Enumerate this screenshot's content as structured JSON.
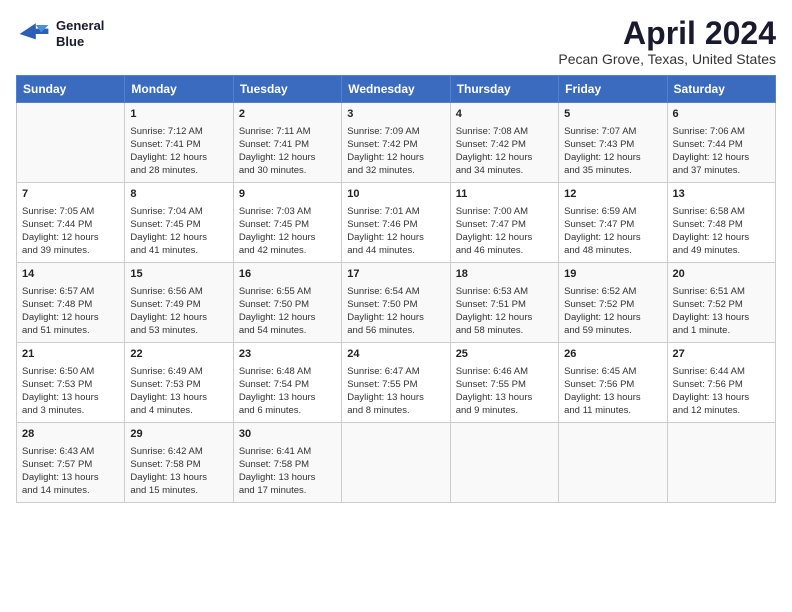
{
  "logo": {
    "line1": "General",
    "line2": "Blue"
  },
  "title": "April 2024",
  "subtitle": "Pecan Grove, Texas, United States",
  "days_header": [
    "Sunday",
    "Monday",
    "Tuesday",
    "Wednesday",
    "Thursday",
    "Friday",
    "Saturday"
  ],
  "weeks": [
    [
      {
        "day": "",
        "info": ""
      },
      {
        "day": "1",
        "info": "Sunrise: 7:12 AM\nSunset: 7:41 PM\nDaylight: 12 hours\nand 28 minutes."
      },
      {
        "day": "2",
        "info": "Sunrise: 7:11 AM\nSunset: 7:41 PM\nDaylight: 12 hours\nand 30 minutes."
      },
      {
        "day": "3",
        "info": "Sunrise: 7:09 AM\nSunset: 7:42 PM\nDaylight: 12 hours\nand 32 minutes."
      },
      {
        "day": "4",
        "info": "Sunrise: 7:08 AM\nSunset: 7:42 PM\nDaylight: 12 hours\nand 34 minutes."
      },
      {
        "day": "5",
        "info": "Sunrise: 7:07 AM\nSunset: 7:43 PM\nDaylight: 12 hours\nand 35 minutes."
      },
      {
        "day": "6",
        "info": "Sunrise: 7:06 AM\nSunset: 7:44 PM\nDaylight: 12 hours\nand 37 minutes."
      }
    ],
    [
      {
        "day": "7",
        "info": "Sunrise: 7:05 AM\nSunset: 7:44 PM\nDaylight: 12 hours\nand 39 minutes."
      },
      {
        "day": "8",
        "info": "Sunrise: 7:04 AM\nSunset: 7:45 PM\nDaylight: 12 hours\nand 41 minutes."
      },
      {
        "day": "9",
        "info": "Sunrise: 7:03 AM\nSunset: 7:45 PM\nDaylight: 12 hours\nand 42 minutes."
      },
      {
        "day": "10",
        "info": "Sunrise: 7:01 AM\nSunset: 7:46 PM\nDaylight: 12 hours\nand 44 minutes."
      },
      {
        "day": "11",
        "info": "Sunrise: 7:00 AM\nSunset: 7:47 PM\nDaylight: 12 hours\nand 46 minutes."
      },
      {
        "day": "12",
        "info": "Sunrise: 6:59 AM\nSunset: 7:47 PM\nDaylight: 12 hours\nand 48 minutes."
      },
      {
        "day": "13",
        "info": "Sunrise: 6:58 AM\nSunset: 7:48 PM\nDaylight: 12 hours\nand 49 minutes."
      }
    ],
    [
      {
        "day": "14",
        "info": "Sunrise: 6:57 AM\nSunset: 7:48 PM\nDaylight: 12 hours\nand 51 minutes."
      },
      {
        "day": "15",
        "info": "Sunrise: 6:56 AM\nSunset: 7:49 PM\nDaylight: 12 hours\nand 53 minutes."
      },
      {
        "day": "16",
        "info": "Sunrise: 6:55 AM\nSunset: 7:50 PM\nDaylight: 12 hours\nand 54 minutes."
      },
      {
        "day": "17",
        "info": "Sunrise: 6:54 AM\nSunset: 7:50 PM\nDaylight: 12 hours\nand 56 minutes."
      },
      {
        "day": "18",
        "info": "Sunrise: 6:53 AM\nSunset: 7:51 PM\nDaylight: 12 hours\nand 58 minutes."
      },
      {
        "day": "19",
        "info": "Sunrise: 6:52 AM\nSunset: 7:52 PM\nDaylight: 12 hours\nand 59 minutes."
      },
      {
        "day": "20",
        "info": "Sunrise: 6:51 AM\nSunset: 7:52 PM\nDaylight: 13 hours\nand 1 minute."
      }
    ],
    [
      {
        "day": "21",
        "info": "Sunrise: 6:50 AM\nSunset: 7:53 PM\nDaylight: 13 hours\nand 3 minutes."
      },
      {
        "day": "22",
        "info": "Sunrise: 6:49 AM\nSunset: 7:53 PM\nDaylight: 13 hours\nand 4 minutes."
      },
      {
        "day": "23",
        "info": "Sunrise: 6:48 AM\nSunset: 7:54 PM\nDaylight: 13 hours\nand 6 minutes."
      },
      {
        "day": "24",
        "info": "Sunrise: 6:47 AM\nSunset: 7:55 PM\nDaylight: 13 hours\nand 8 minutes."
      },
      {
        "day": "25",
        "info": "Sunrise: 6:46 AM\nSunset: 7:55 PM\nDaylight: 13 hours\nand 9 minutes."
      },
      {
        "day": "26",
        "info": "Sunrise: 6:45 AM\nSunset: 7:56 PM\nDaylight: 13 hours\nand 11 minutes."
      },
      {
        "day": "27",
        "info": "Sunrise: 6:44 AM\nSunset: 7:56 PM\nDaylight: 13 hours\nand 12 minutes."
      }
    ],
    [
      {
        "day": "28",
        "info": "Sunrise: 6:43 AM\nSunset: 7:57 PM\nDaylight: 13 hours\nand 14 minutes."
      },
      {
        "day": "29",
        "info": "Sunrise: 6:42 AM\nSunset: 7:58 PM\nDaylight: 13 hours\nand 15 minutes."
      },
      {
        "day": "30",
        "info": "Sunrise: 6:41 AM\nSunset: 7:58 PM\nDaylight: 13 hours\nand 17 minutes."
      },
      {
        "day": "",
        "info": ""
      },
      {
        "day": "",
        "info": ""
      },
      {
        "day": "",
        "info": ""
      },
      {
        "day": "",
        "info": ""
      }
    ]
  ]
}
